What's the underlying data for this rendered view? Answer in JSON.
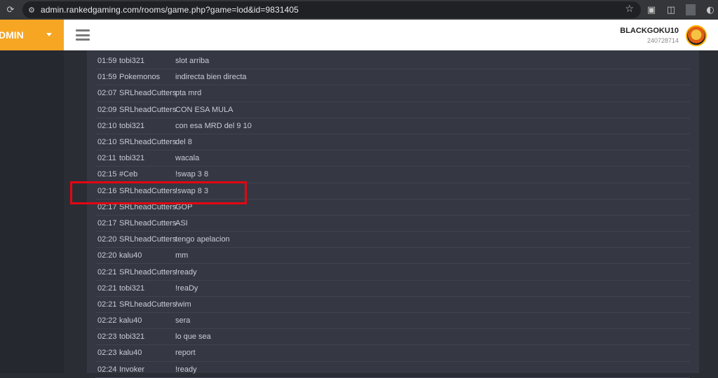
{
  "browser": {
    "url": "admin.rankedgaming.com/rooms/game.php?game=lod&id=9831405",
    "icons": [
      "reload-icon",
      "site-settings-icon",
      "bookmark-star-icon",
      "cast-icon",
      "extensions-icon",
      "profile-icon",
      "menu-icon"
    ]
  },
  "header": {
    "brand_label": "DMIN",
    "username": "BLACKGOKU10",
    "user_id": "240728714"
  },
  "colors": {
    "brand": "#f6a623",
    "highlight": "#e30613",
    "panel": "#353843"
  },
  "chat": {
    "rows": [
      {
        "time": "01:59",
        "user": "tobi321",
        "message": "slot arriba"
      },
      {
        "time": "01:59",
        "user": "Pokemonos",
        "message": "indirecta bien directa"
      },
      {
        "time": "02:07",
        "user": "SRLheadCutters",
        "message": "pta mrd"
      },
      {
        "time": "02:09",
        "user": "SRLheadCutters",
        "message": "CON ESA MULA"
      },
      {
        "time": "02:10",
        "user": "tobi321",
        "message": "con esa MRD del 9 10"
      },
      {
        "time": "02:10",
        "user": "SRLheadCutters",
        "message": "del 8"
      },
      {
        "time": "02:11",
        "user": "tobi321",
        "message": "wacala"
      },
      {
        "time": "02:15",
        "user": "#Ceb",
        "message": "!swap 3 8"
      },
      {
        "time": "02:16",
        "user": "SRLheadCutters",
        "message": "!swap 8 3"
      },
      {
        "time": "02:17",
        "user": "SRLheadCutters",
        "message": "GOP"
      },
      {
        "time": "02:17",
        "user": "SRLheadCutters",
        "message": "ASI"
      },
      {
        "time": "02:20",
        "user": "SRLheadCutters",
        "message": "tengo apelacion"
      },
      {
        "time": "02:20",
        "user": "kalu40",
        "message": "mm"
      },
      {
        "time": "02:21",
        "user": "SRLheadCutters",
        "message": "!ready"
      },
      {
        "time": "02:21",
        "user": "tobi321",
        "message": "!reaDy"
      },
      {
        "time": "02:21",
        "user": "SRLheadCutters",
        "message": "!wim"
      },
      {
        "time": "02:22",
        "user": "kalu40",
        "message": "sera"
      },
      {
        "time": "02:23",
        "user": "tobi321",
        "message": "lo que sea"
      },
      {
        "time": "02:23",
        "user": "kalu40",
        "message": "report"
      },
      {
        "time": "02:24",
        "user": "Invoker",
        "message": "!ready"
      }
    ]
  }
}
